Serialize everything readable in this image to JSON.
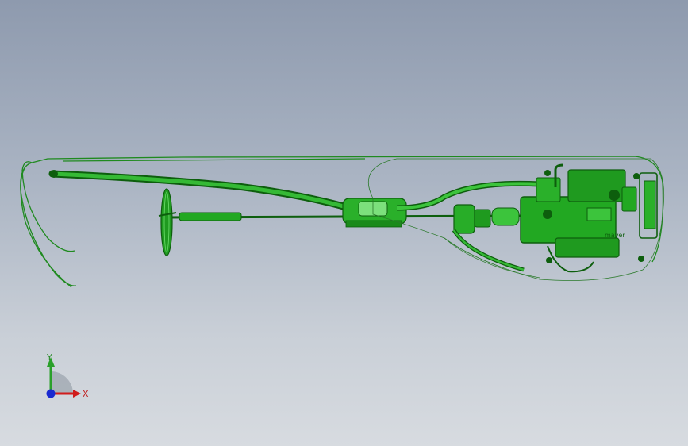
{
  "viewport": {
    "background_top": "#8e9aae",
    "background_bottom": "#d7dbe0",
    "model_color": "#1f9a1f",
    "model_dark": "#0d5e0d",
    "model_light": "#6ee06e"
  },
  "triad": {
    "x_label": "X",
    "y_label": "Y",
    "x_color": "#d01c1c",
    "y_color": "#2aa02a",
    "z_color": "#1a2ad0"
  },
  "model": {
    "part_label": "mayer"
  }
}
